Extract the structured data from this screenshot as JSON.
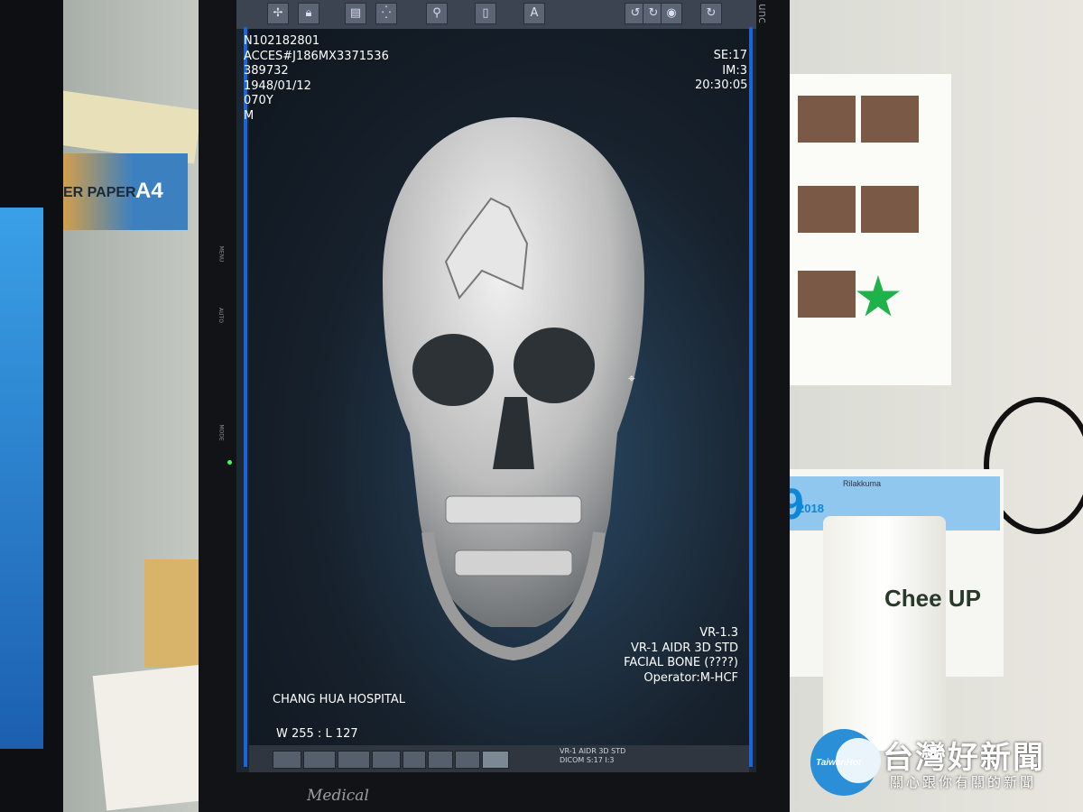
{
  "viewer": {
    "top_left": {
      "patient_id": "N102182801",
      "accession": "ACCES#J186MX3371536",
      "number": "389732",
      "birth_date": "1948/01/12",
      "age": "070Y",
      "sex": "M"
    },
    "top_right": {
      "series": "SE:17",
      "image": "IM:3",
      "time": "20:30:05"
    },
    "bottom_right": {
      "version": "VR-1.3",
      "recon": "VR-1   AIDR 3D STD",
      "protocol": "FACIAL BONE (????)",
      "operator": "Operator:M-HCF"
    },
    "bottom_left": {
      "hospital": "CHANG HUA HOSPITAL",
      "window": "W 255 : L 127"
    },
    "taskbar_info": {
      "line1": "VR-1  AIDR 3D STD",
      "line2": "DICOM S:17 I:3"
    },
    "toolbar_icons": [
      "move-icon",
      "lock-icon",
      "grid-icon",
      "pan-icon",
      "zoom-icon",
      "page-icon",
      "text-icon",
      "rotate-left-icon",
      "rotate-right-icon",
      "circle-icon",
      "refresh-icon"
    ]
  },
  "monitor": {
    "brand_bottom": "Medical",
    "side_labels": [
      "MENU",
      "AUTO",
      "MODE"
    ]
  },
  "background": {
    "paper_label": "ER PAPER",
    "paper_size": "A4",
    "calendar_day": "9",
    "calendar_year": "2018",
    "calendar_brand": "Rilakkuma",
    "cup_text": "Chee UP"
  },
  "watermark": {
    "logo": "TaiwanHot",
    "title": "台灣好新聞",
    "subtitle": "關心跟你有關的新聞"
  }
}
